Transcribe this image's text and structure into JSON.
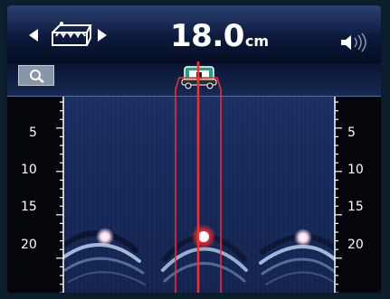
{
  "header": {
    "depth_value": "18.0",
    "depth_unit": "cm"
  },
  "icons": {
    "left": "arrow-left-icon",
    "mode": "scan-mode-icon",
    "right": "arrow-right-icon",
    "speaker": "speaker-icon",
    "search": "magnifier-icon",
    "device": "scanner-device-icon"
  },
  "colors": {
    "laser": "#ff2a2a",
    "scan_bg": "#1a2e62",
    "target": "#ffe8f0"
  },
  "ruler": {
    "left_labels": [
      "5",
      "10",
      "15",
      "20"
    ],
    "right_labels": [
      "5",
      "10",
      "15",
      "20"
    ]
  }
}
